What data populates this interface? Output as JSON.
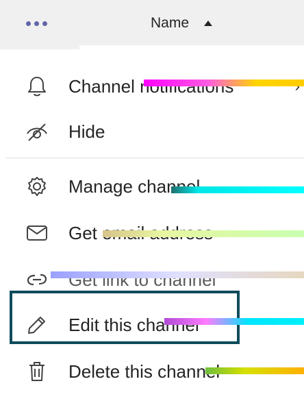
{
  "header": {
    "column_label": "Name",
    "sort_direction": "ascending"
  },
  "menu": {
    "items": [
      {
        "label": "Channel notifications",
        "icon": "bell-icon",
        "has_submenu": true
      },
      {
        "label": "Hide",
        "icon": "eye-off-icon",
        "has_submenu": false
      },
      {
        "label": "Manage channel",
        "icon": "gear-icon",
        "has_submenu": false
      },
      {
        "label": "Get email address",
        "icon": "mail-icon",
        "has_submenu": false
      },
      {
        "label": "Get link to channel",
        "icon": "link-icon",
        "has_submenu": false
      },
      {
        "label": "Edit this channel",
        "icon": "pencil-icon",
        "has_submenu": false
      },
      {
        "label": "Delete this channel",
        "icon": "trash-icon",
        "has_submenu": false
      }
    ],
    "focused_item": "Edit this channel"
  },
  "colors": {
    "accent": "#6264a7",
    "header_bg": "#f0f0f0",
    "focus_outline": "#0f4c5c",
    "text": "#242424"
  }
}
